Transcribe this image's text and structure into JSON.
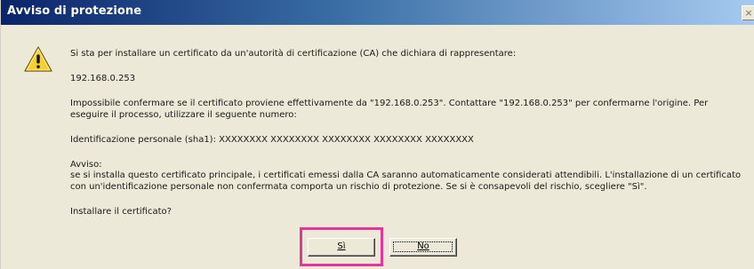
{
  "dialog": {
    "title": "Avviso di protezione",
    "close_glyph": "×",
    "icon": "warning-icon"
  },
  "message": {
    "intro": "Si sta per installare un certificato da un'autorità di certificazione (CA) che dichiara di rappresentare:",
    "host": "192.168.0.253",
    "unconfirmed_line1": "Impossibile confermare se il certificato proviene effettivamente da \"192.168.0.253\". Contattare \"192.168.0.253\" per confermarne l'origine. Per",
    "unconfirmed_line2": "eseguire il processo, utilizzare il seguente numero:",
    "thumbprint": "Identificazione personale (sha1): XXXXXXXX XXXXXXXX XXXXXXXX XXXXXXXX XXXXXXXX",
    "warning_heading": "Avviso:",
    "warning_line1": "se si installa questo certificato principale, i certificati emessi dalla CA saranno automaticamente considerati attendibili. L'installazione di un certificato",
    "warning_line2": "con un'identificazione personale non confermata comporta un rischio di protezione. Se si è consapevoli del rischio, scegliere \"Sì\".",
    "question": "Installare il certificato?"
  },
  "buttons": {
    "yes_label": "Sì",
    "no_label": "No"
  },
  "colors": {
    "title_bar_start": "#0a246a",
    "title_bar_end": "#a6caf0",
    "dialog_background": "#ece9d8",
    "highlight": "#e8339a",
    "warning_yellow": "#f7d02a"
  }
}
